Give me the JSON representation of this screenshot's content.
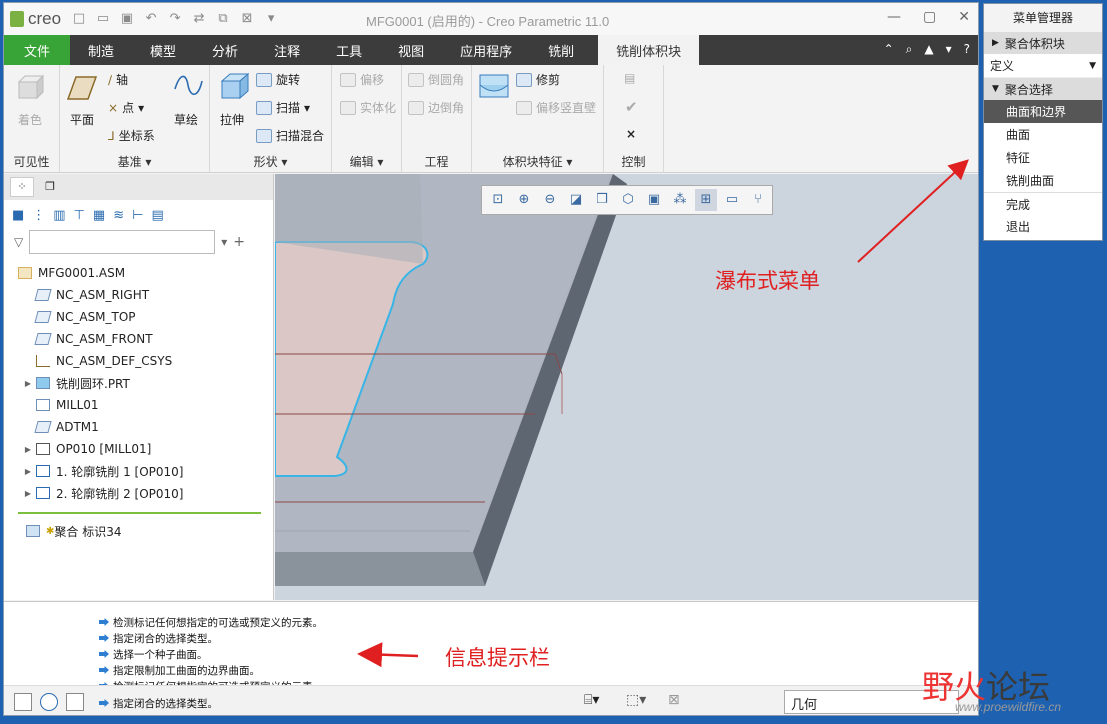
{
  "app": {
    "logo": "creo",
    "title": "MFG0001 (启用的) - Creo Parametric 11.0"
  },
  "tabs": [
    "文件",
    "制造",
    "模型",
    "分析",
    "注释",
    "工具",
    "视图",
    "应用程序",
    "铣削",
    "铣削体积块"
  ],
  "ribbon": {
    "visibility": {
      "btn": "着色",
      "label": "可见性"
    },
    "datum": {
      "plane": "平面",
      "axis": "轴",
      "point": "点",
      "csys": "坐标系",
      "sketch": "草绘",
      "label": "基准"
    },
    "shapes": {
      "extrude": "拉伸",
      "revolve": "旋转",
      "sweep": "扫描",
      "blend": "扫描混合",
      "label": "形状"
    },
    "editing": {
      "offset": "偏移",
      "solidify": "实体化",
      "label": "编辑"
    },
    "engineering": {
      "round": "倒圆角",
      "chamfer": "边倒角",
      "label": "工程"
    },
    "volfeat": {
      "trim": "修剪",
      "offset_vert": "偏移竖直壁",
      "label": "体积块特征"
    },
    "control": {
      "label": "控制"
    }
  },
  "tree": {
    "root": "MFG0001.ASM",
    "items": [
      "NC_ASM_RIGHT",
      "NC_ASM_TOP",
      "NC_ASM_FRONT",
      "NC_ASM_DEF_CSYS",
      "铣削圆环.PRT",
      "MILL01",
      "ADTM1",
      "OP010 [MILL01]",
      "1. 轮廓铣削 1 [OP010]",
      "2. 轮廓铣削 2 [OP010]"
    ],
    "insert": "聚合 标识34"
  },
  "messages": [
    "检测标记任何想指定的可选或预定义的元素。",
    "指定闭合的选择类型。",
    "选择一个种子曲面。",
    "指定限制加工曲面的边界曲面。",
    "检测标记任何想指定的可选或预定义的元素。",
    "指定闭合的选择类型。"
  ],
  "status": {
    "selection_filter": "几何"
  },
  "menu_manager": {
    "title": "菜单管理器",
    "section1": "聚合体积块",
    "dropdown": "定义",
    "section2": "聚合选择",
    "items": [
      "曲面和边界",
      "曲面",
      "特征",
      "铣削曲面"
    ],
    "done": "完成",
    "quit": "退出"
  },
  "annotations": {
    "waterfall": "瀑布式菜单",
    "infobar": "信息提示栏"
  },
  "watermark": {
    "text_a": "野",
    "text_b": "火",
    "text_c": "论坛",
    "url": "www.proewildfire.cn"
  }
}
